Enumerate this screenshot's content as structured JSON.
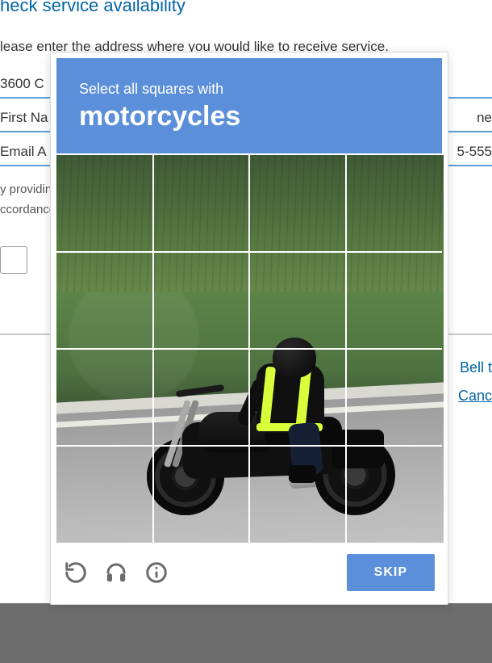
{
  "background": {
    "heading_fragment": "heck service availability",
    "lead": "lease enter the address where you would like to receive service.",
    "fields": {
      "address": {
        "left": "3600 C",
        "right": ""
      },
      "name": {
        "left": "First Na",
        "right": "ne"
      },
      "email": {
        "left": "Email A",
        "right": "5-555"
      }
    },
    "hint_left": "y providing my contact information, I consent to receive marketi",
    "hint_left2": "ccordance with our privacy policy. You may choose to unsubscribe",
    "links": {
      "bell": "Bell t",
      "cancel": "Canc"
    }
  },
  "captcha": {
    "prefix": "Select all squares with",
    "category": "motorcycles",
    "skip_label": "SKIP",
    "grid": {
      "rows": 4,
      "cols": 4
    },
    "icons": {
      "reload": "reload-icon",
      "audio": "headphones-icon",
      "info": "info-icon"
    }
  }
}
